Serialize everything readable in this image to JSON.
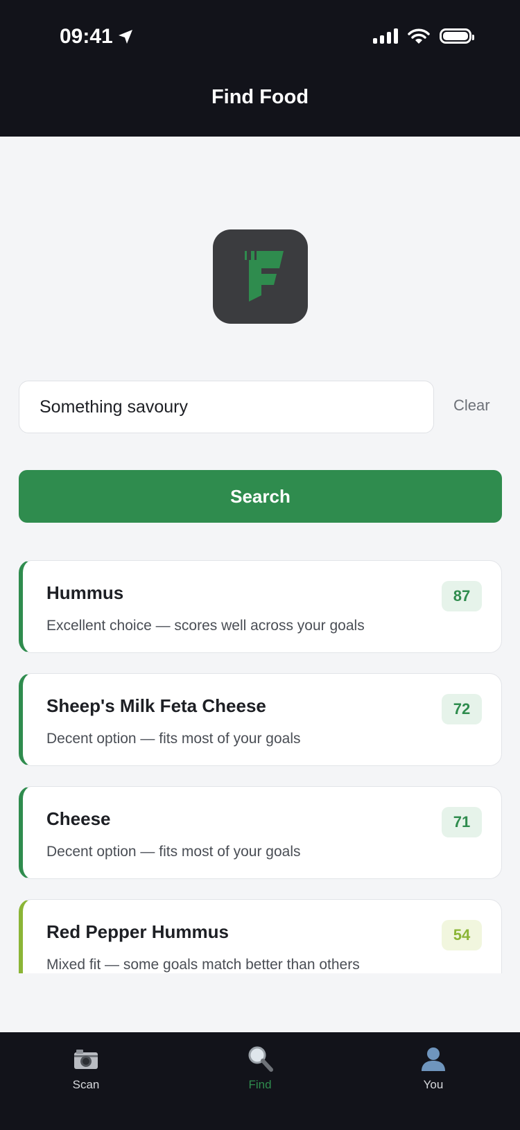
{
  "status_bar": {
    "time": "09:41",
    "icons": [
      "location-arrow-icon",
      "signal-icon",
      "wifi-icon",
      "battery-icon"
    ]
  },
  "header": {
    "title": "Find Food"
  },
  "logo": {
    "icon": "app-logo-f",
    "colors": {
      "tile": "#3b3c3f",
      "letter": "#2f8c4e"
    }
  },
  "search": {
    "value": "Something savoury",
    "clear_label": "Clear",
    "button_label": "Search"
  },
  "results": [
    {
      "name": "Hummus",
      "summary": "Excellent choice — scores well across your goals",
      "score": "87",
      "rating": "good"
    },
    {
      "name": "Sheep's Milk Feta Cheese",
      "summary": "Decent option — fits most of your goals",
      "score": "72",
      "rating": "good"
    },
    {
      "name": "Cheese",
      "summary": "Decent option — fits most of your goals",
      "score": "71",
      "rating": "good"
    },
    {
      "name": "Red Pepper Hummus",
      "summary": "Mixed fit — some goals match better than others",
      "score": "54",
      "rating": "mixed"
    }
  ],
  "tabs": [
    {
      "label": "Scan",
      "icon": "camera-icon",
      "active": false
    },
    {
      "label": "Find",
      "icon": "magnifier-icon",
      "active": true
    },
    {
      "label": "You",
      "icon": "person-icon",
      "active": false
    }
  ],
  "colors": {
    "accent": "#2f8c4e",
    "mixed": "#8bb536",
    "header_bg": "#12131a",
    "page_bg": "#f4f5f7"
  }
}
